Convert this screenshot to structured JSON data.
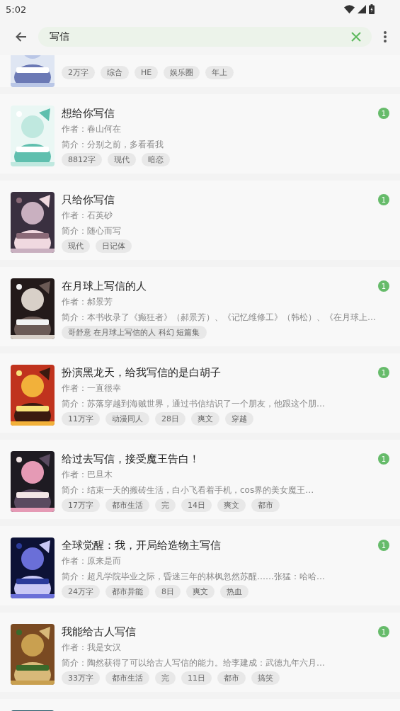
{
  "status_bar": {
    "time": "5:02"
  },
  "search": {
    "value": "写信"
  },
  "results": [
    {
      "kind": "cut_top",
      "tags": [
        "2万字",
        "综合",
        "HE",
        "娱乐圈",
        "年上"
      ]
    },
    {
      "kind": "full",
      "title": "想给你写信",
      "author": "作者：春山何在",
      "intro": "简介：分别之前，多看看我",
      "tags": [
        "8812字",
        "现代",
        "暗恋"
      ],
      "badge": "1"
    },
    {
      "kind": "full",
      "title": "只给你写信",
      "author": "作者：石英砂",
      "intro": "简介：随心而写",
      "tags": [
        "现代",
        "日记体"
      ],
      "badge": "1"
    },
    {
      "kind": "full",
      "title": "在月球上写信的人",
      "author": "作者：郝景芳",
      "intro": "简介：本书收录了《癫狂者》（郝景芳）、《记忆维修工》（韩松）、《在月球上…",
      "tags": [
        "哥舒意 在月球上写信的人 科幻 短篇集"
      ],
      "badge": "1"
    },
    {
      "kind": "full",
      "title": "扮演黑龙天，给我写信的是白胡子",
      "author": "作者：一直很幸",
      "intro": "简介：苏落穿越到海贼世界，通过书信结识了一个朋友，他跟这个朋…",
      "tags": [
        "11万字",
        "动漫同人",
        "28日",
        "爽文",
        "穿越"
      ],
      "badge": "1"
    },
    {
      "kind": "full",
      "title": "给过去写信，接受魔王告白！",
      "author": "作者：巴旦木",
      "intro": "简介：结束一天的搬砖生活，白小飞看着手机，cos界的美女魔王…",
      "tags": [
        "17万字",
        "都市生活",
        "完",
        "14日",
        "爽文",
        "都市"
      ],
      "badge": "1"
    },
    {
      "kind": "full",
      "title": "全球觉醒：我，开局给造物主写信",
      "author": "作者：原来是而",
      "intro": "简介：超凡学院毕业之际，昏迷三年的林枫忽然苏醒……张猛：哈哈…",
      "tags": [
        "24万字",
        "都市异能",
        "8日",
        "爽文",
        "热血"
      ],
      "badge": "1"
    },
    {
      "kind": "full",
      "title": "我能给古人写信",
      "author": "作者：我是女汉",
      "intro": "简介：陶然获得了可以给古人写信的能力。给李建成：武德九年六月…",
      "tags": [
        "33万字",
        "都市生活",
        "完",
        "11日",
        "都市",
        "搞笑"
      ],
      "badge": "1"
    },
    {
      "kind": "cut_bottom"
    }
  ]
}
